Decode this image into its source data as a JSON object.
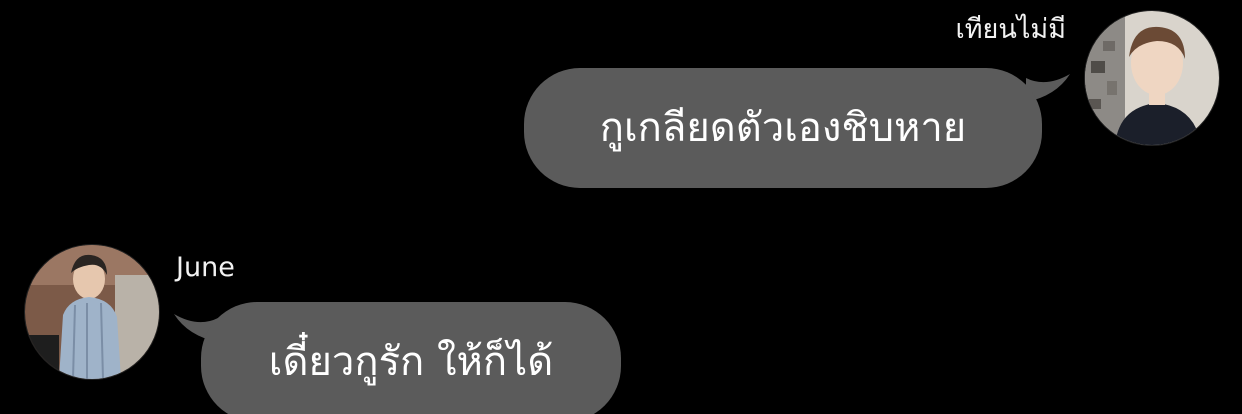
{
  "messages": [
    {
      "side": "right",
      "sender": "เทียนไม่มี",
      "text": "กูเกลียดตัวเองชิบหาย",
      "avatar": "avatar-photo"
    },
    {
      "side": "left",
      "sender": "June",
      "text": "เดี๋ยวกูรัก ให้ก็ได้",
      "avatar": "avatar-photo"
    }
  ],
  "colors": {
    "background": "#000000",
    "bubble": "#5b5b5b",
    "text": "#ffffff"
  }
}
